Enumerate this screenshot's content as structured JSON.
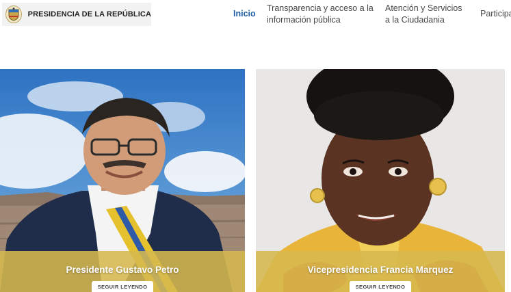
{
  "header": {
    "brand_name": "PRESIDENCIA DE LA REPÚBLICA",
    "nav": [
      {
        "label": "Inicio",
        "active": true
      },
      {
        "label_line1": "Transparencia y acceso a la",
        "label_line2": "información pública"
      },
      {
        "label_line1": "Atención y Servicios",
        "label_line2": "a la Ciudadania"
      },
      {
        "label": "Participa"
      }
    ]
  },
  "cards": [
    {
      "title": "Presidente Gustavo Petro",
      "button": "SEGUIR LEYENDO"
    },
    {
      "title": "Vicepresidencia Francia Marquez",
      "button": "SEGUIR LEYENDO"
    }
  ],
  "colors": {
    "nav_active": "#1f5fa8",
    "overlay": "#d6b84e",
    "sky": "#3d7fc8"
  }
}
